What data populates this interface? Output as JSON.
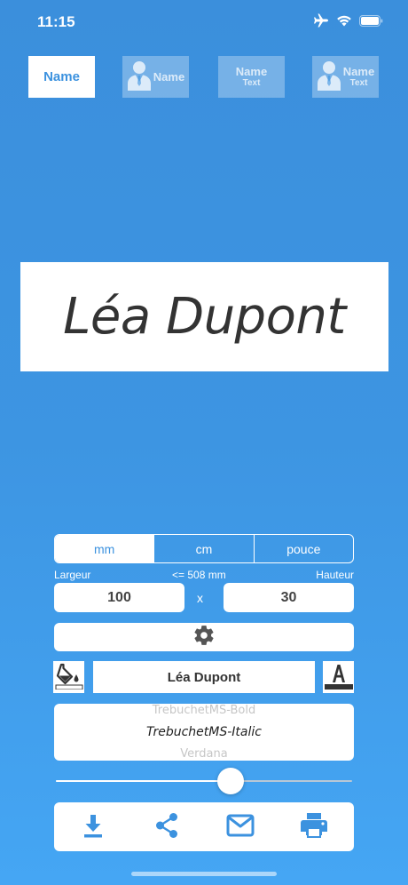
{
  "status_bar": {
    "time": "11:15"
  },
  "templates": [
    {
      "name": "Name",
      "sub": ""
    },
    {
      "name": "Name",
      "sub": ""
    },
    {
      "name": "Name",
      "sub": "Text"
    },
    {
      "name": "Name",
      "sub": "Text"
    }
  ],
  "preview": {
    "text": "Léa Dupont"
  },
  "units": {
    "options": [
      "mm",
      "cm",
      "pouce"
    ],
    "selected": "mm"
  },
  "dimensions": {
    "width_label": "Largeur",
    "limit_label": "<= 508 mm",
    "height_label": "Hauteur",
    "width_value": "100",
    "height_value": "30",
    "separator": "x"
  },
  "text_input": {
    "value": "Léa Dupont"
  },
  "font_picker": {
    "previous": "TrebuchetMS-Bold",
    "selected": "TrebuchetMS-Italic",
    "next": "Verdana"
  },
  "size_slider": {
    "value_fraction": 0.59
  },
  "colors": {
    "accent": "#3c92df",
    "background_top": "#3b8fdc",
    "background_bottom": "#45a6f4",
    "text_dark": "#333333"
  },
  "icons": [
    "airplane-icon",
    "wifi-icon",
    "battery-icon",
    "person-icon",
    "gear-icon",
    "paint-bucket-icon",
    "font-color-icon",
    "download-icon",
    "share-icon",
    "mail-icon",
    "printer-icon"
  ]
}
